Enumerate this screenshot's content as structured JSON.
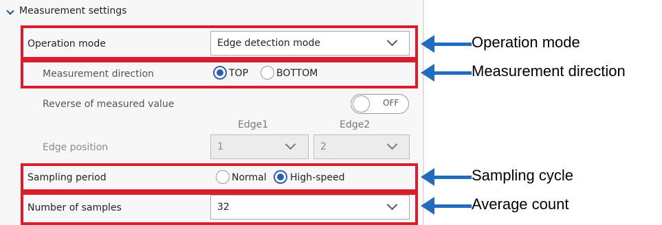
{
  "section": {
    "title": "Measurement settings"
  },
  "operation_mode": {
    "label": "Operation mode",
    "value": "Edge detection mode"
  },
  "measurement_direction": {
    "label": "Measurement direction",
    "options": [
      {
        "label": "TOP",
        "selected": true
      },
      {
        "label": "BOTTOM",
        "selected": false
      }
    ]
  },
  "reverse": {
    "label": "Reverse of measured value",
    "toggle_state": "OFF"
  },
  "edge_position": {
    "label": "Edge position",
    "columns": [
      "Edge1",
      "Edge2"
    ],
    "edge1_value": "1",
    "edge2_value": "2"
  },
  "sampling_period": {
    "label": "Sampling period",
    "options": [
      {
        "label": "Normal",
        "selected": false
      },
      {
        "label": "High-speed",
        "selected": true
      }
    ]
  },
  "number_of_samples": {
    "label": "Number of samples",
    "value": "32"
  },
  "callouts": {
    "operation_mode": "Operation mode",
    "measurement_direction": "Measurement direction",
    "sampling_cycle": "Sampling cycle",
    "average_count": "Average count"
  },
  "colors": {
    "highlight": "#d81e2c",
    "arrow": "#1f6cc0",
    "selected_radio": "#2d5fb0"
  }
}
